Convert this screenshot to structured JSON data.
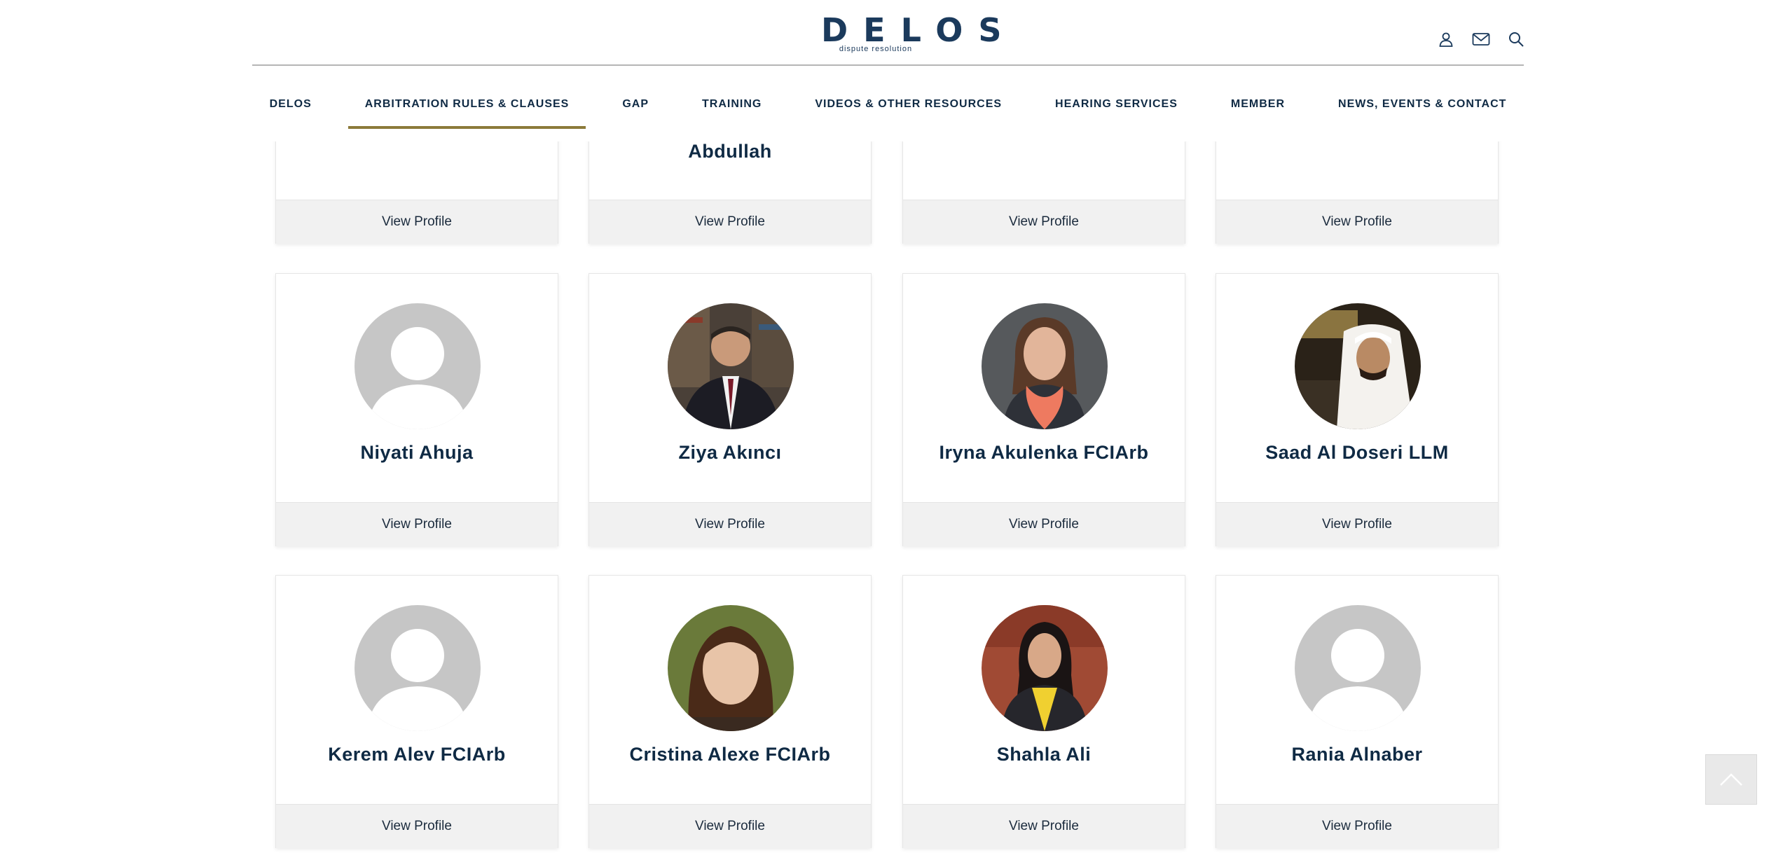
{
  "header": {
    "logo_text": "DELOS",
    "logo_tagline": "dispute resolution",
    "icons": [
      "user-icon",
      "mail-icon",
      "search-icon"
    ]
  },
  "nav": {
    "items": [
      {
        "label": "DELOS"
      },
      {
        "label": "ARBITRATION RULES & CLAUSES"
      },
      {
        "label": "GAP"
      },
      {
        "label": "TRAINING"
      },
      {
        "label": "VIDEOS & OTHER RESOURCES"
      },
      {
        "label": "HEARING SERVICES"
      },
      {
        "label": "MEMBER"
      },
      {
        "label": "NEWS, EVENTS & CONTACT"
      }
    ],
    "active": "ARBITRATION RULES & CLAUSES",
    "accent_color": "#8c7a3a"
  },
  "cards": {
    "view_profile_label": "View Profile",
    "row0": [
      {
        "name": ""
      },
      {
        "name": "Abdullah"
      },
      {
        "name": ""
      },
      {
        "name": ""
      }
    ],
    "row1": [
      {
        "name": "Niyati Ahuja",
        "photo": "placeholder"
      },
      {
        "name": "Ziya Akıncı",
        "photo": "man-suit-bookshelf"
      },
      {
        "name": "Iryna Akulenka FCIArb",
        "photo": "woman-orange-scarf"
      },
      {
        "name": "Saad Al Doseri LLM",
        "photo": "man-white-ghutra"
      }
    ],
    "row2": [
      {
        "name": "Kerem Alev FCIArb",
        "photo": "placeholder"
      },
      {
        "name": "Cristina Alexe FCIArb",
        "photo": "woman-brown-hair"
      },
      {
        "name": "Shahla Ali",
        "photo": "woman-dark-blazer"
      },
      {
        "name": "Rania Alnaber",
        "photo": "placeholder"
      }
    ]
  },
  "colors": {
    "text": "#0f2a44",
    "button_bg": "#f1f1f1"
  }
}
